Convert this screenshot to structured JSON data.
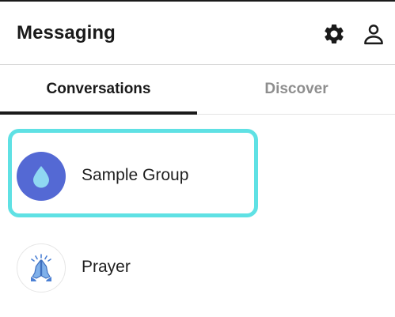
{
  "header": {
    "title": "Messaging",
    "icons": [
      "settings-gear-icon",
      "profile-person-icon"
    ]
  },
  "tabs": [
    {
      "label": "Conversations",
      "active": true
    },
    {
      "label": "Discover",
      "active": false
    }
  ],
  "conversations": [
    {
      "name": "Sample Group",
      "avatar_icon": "water-drop-icon",
      "avatar_color": "#5469d4",
      "highlighted": true
    },
    {
      "name": "Prayer",
      "avatar_icon": "praying-hands-icon",
      "avatar_color": "#ffffff",
      "highlighted": false
    }
  ],
  "colors": {
    "highlight": "#5fe1e4",
    "active_tab": "#1a1a1a",
    "inactive_tab": "#8e8e8e"
  }
}
